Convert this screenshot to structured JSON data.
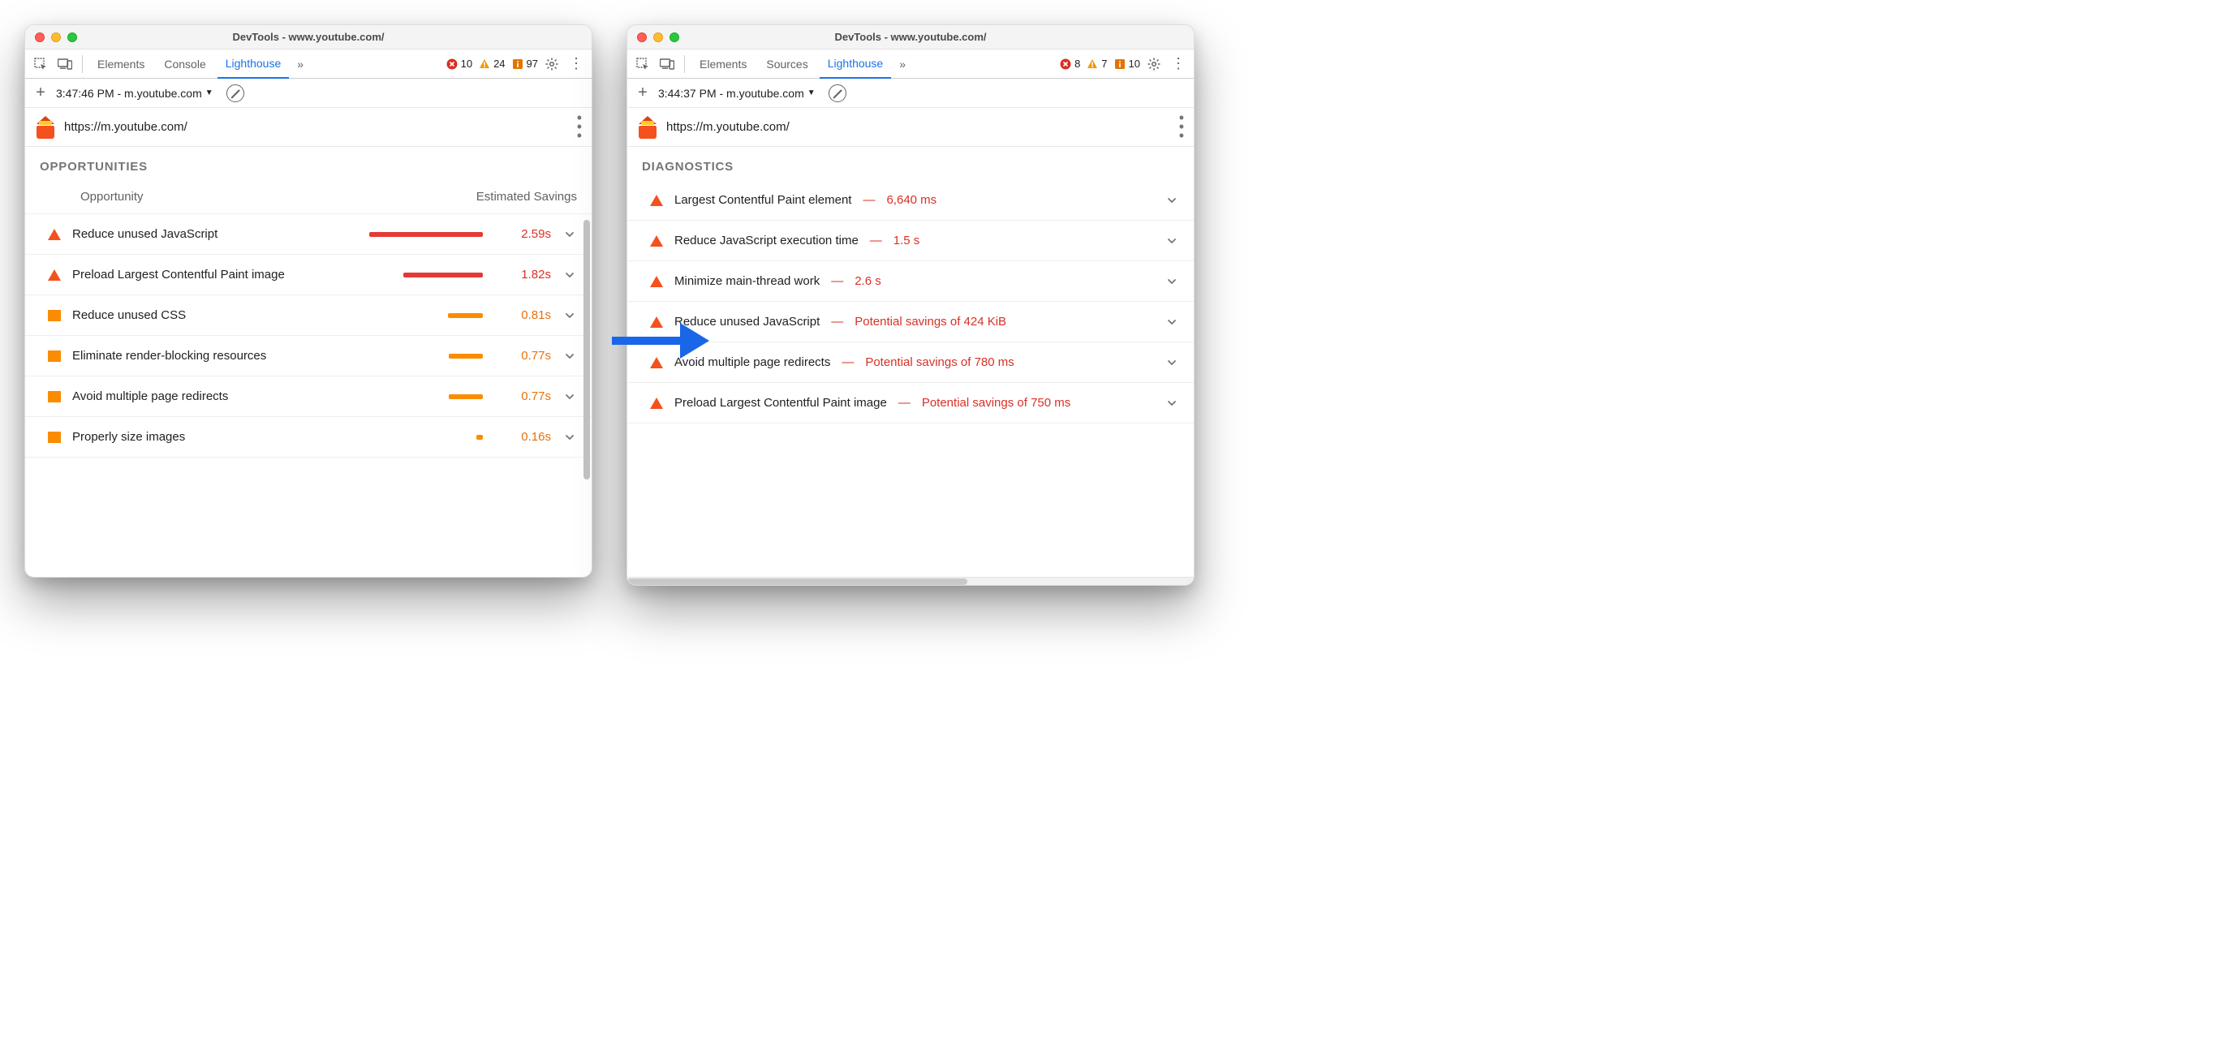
{
  "arrow_color": "#1967e8",
  "colors": {
    "accent": "#1a73e8",
    "error": "#d93025",
    "warn": "#e8710a",
    "marker_red": "#f4511e",
    "marker_orange": "#fb8c00"
  },
  "left": {
    "title": "DevTools - www.youtube.com/",
    "tabs": [
      "Elements",
      "Console",
      "Lighthouse"
    ],
    "active_tab": "Lighthouse",
    "overflow": "»",
    "badges": {
      "error": 10,
      "warn": 24,
      "info": 97
    },
    "run_selector": "3:47:46 PM - m.youtube.com",
    "url": "https://m.youtube.com/",
    "section": "OPPORTUNITIES",
    "columns": {
      "left": "Opportunity",
      "right": "Estimated Savings"
    },
    "rows": [
      {
        "marker": "tri",
        "label": "Reduce unused JavaScript",
        "value": "2.59s",
        "tone": "red",
        "bar_pct": 100
      },
      {
        "marker": "tri",
        "label": "Preload Largest Contentful Paint image",
        "value": "1.82s",
        "tone": "red",
        "bar_pct": 70
      },
      {
        "marker": "sq",
        "label": "Reduce unused CSS",
        "value": "0.81s",
        "tone": "orange",
        "bar_pct": 31
      },
      {
        "marker": "sq",
        "label": "Eliminate render-blocking resources",
        "value": "0.77s",
        "tone": "orange",
        "bar_pct": 30
      },
      {
        "marker": "sq",
        "label": "Avoid multiple page redirects",
        "value": "0.77s",
        "tone": "orange",
        "bar_pct": 30
      },
      {
        "marker": "sq",
        "label": "Properly size images",
        "value": "0.16s",
        "tone": "orange",
        "bar_pct": 6
      }
    ]
  },
  "right": {
    "title": "DevTools - www.youtube.com/",
    "tabs": [
      "Elements",
      "Sources",
      "Lighthouse"
    ],
    "active_tab": "Lighthouse",
    "overflow": "»",
    "badges": {
      "error": 8,
      "warn": 7,
      "info": 10
    },
    "run_selector": "3:44:37 PM - m.youtube.com",
    "url": "https://m.youtube.com/",
    "section": "DIAGNOSTICS",
    "rows": [
      {
        "label": "Largest Contentful Paint element",
        "metric": "6,640 ms"
      },
      {
        "label": "Reduce JavaScript execution time",
        "metric": "1.5 s"
      },
      {
        "label": "Minimize main-thread work",
        "metric": "2.6 s"
      },
      {
        "label": "Reduce unused JavaScript",
        "metric": "Potential savings of 424 KiB"
      },
      {
        "label": "Avoid multiple page redirects",
        "metric": "Potential savings of 780 ms"
      },
      {
        "label": "Preload Largest Contentful Paint image",
        "metric": "Potential savings of 750 ms"
      }
    ]
  }
}
